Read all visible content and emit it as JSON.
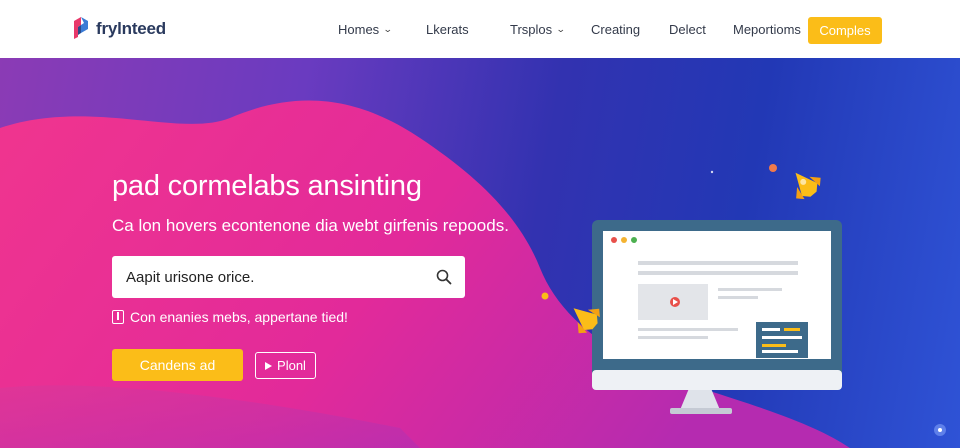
{
  "brand": {
    "name": "frylnteed"
  },
  "nav": {
    "items": [
      {
        "label": "Homes",
        "has_dropdown": true
      },
      {
        "label": "Lkerats",
        "has_dropdown": false
      },
      {
        "label": "Trsplos",
        "has_dropdown": true
      },
      {
        "label": "Creating",
        "has_dropdown": false
      },
      {
        "label": "Delect",
        "has_dropdown": false
      },
      {
        "label": "Meportioms",
        "has_dropdown": false
      }
    ],
    "cta_label": "Comples"
  },
  "hero": {
    "headline": "pad cormelabs ansinting",
    "subline": "Ca lon hovers econtenone dia webt girfenis repoods.",
    "search": {
      "value": "Aapit urisone orice.",
      "icon": "search-icon"
    },
    "checkbox_label": "Con enanies mebs, appertane tied!",
    "primary_button": "Candens ad",
    "secondary_button": "Plonl"
  },
  "colors": {
    "accent": "#fbbd18",
    "pink": "#ec2e92",
    "blue": "#2238b5",
    "monitor_frame": "#3d6a8a"
  }
}
